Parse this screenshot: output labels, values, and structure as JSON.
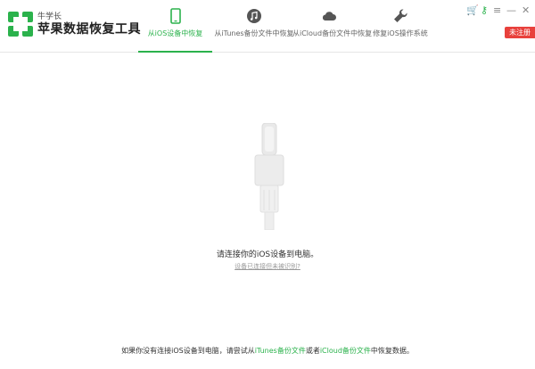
{
  "brand": {
    "small": "牛学长",
    "name": "苹果数据恢复工具",
    "accent_color": "#2bb24c",
    "logo_icon": "recovery-logo-icon"
  },
  "tabs": [
    {
      "label": "从iOS设备中恢复",
      "icon": "phone-icon",
      "active": true
    },
    {
      "label": "从iTunes备份文件中恢复",
      "icon": "music-note-icon",
      "active": false
    },
    {
      "label": "从iCloud备份文件中恢复",
      "icon": "cloud-icon",
      "active": false
    },
    {
      "label": "修复iOS操作系统",
      "icon": "wrench-icon",
      "active": false
    }
  ],
  "window_controls": {
    "cart": "🛒",
    "key": "⚷",
    "menu": "≡",
    "minimize": "—",
    "close": "✕"
  },
  "badge": {
    "label": "未注册",
    "color": "#e8413c"
  },
  "main": {
    "connect_message": "请连接你的iOS设备到电脑。",
    "help_link": "设备已连接但未被识别?"
  },
  "footer": {
    "prefix": "如果你没有连接iOS设备到电脑，请尝试从",
    "itunes_link": "iTunes备份文件",
    "middle": "或者",
    "icloud_link": "iCloud备份文件",
    "suffix": "中恢复数据。"
  }
}
